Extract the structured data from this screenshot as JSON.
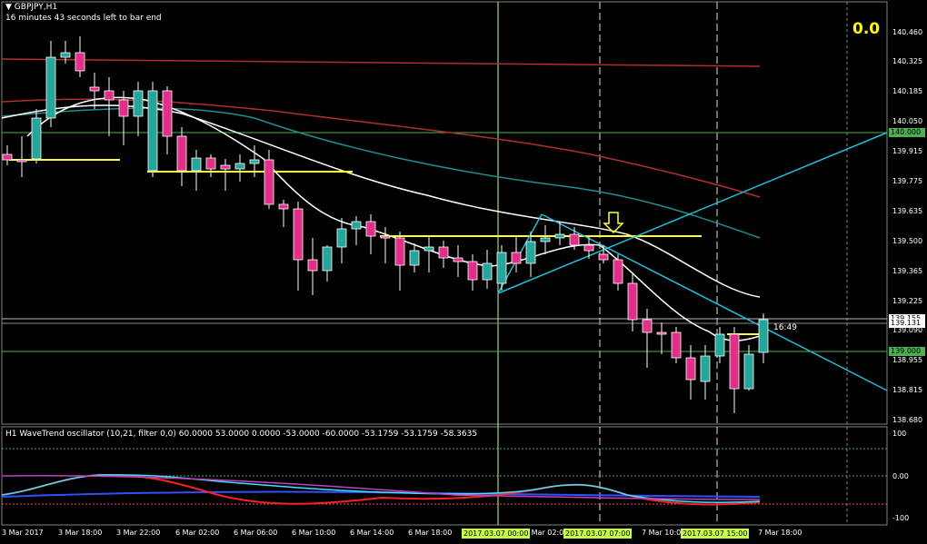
{
  "header": {
    "symbol": "GBPJPY,H1",
    "subtitle": "16 minutes 43 seconds left to bar end",
    "corner_value": "0.0"
  },
  "oscillator": {
    "title": "H1 WaveTrend oscillator (10,21, filter 0,0) 60.0000 53.0000 0.0000 -53.0000 -60.0000 -53.1759 -53.1759 -58.3635",
    "scale": [
      "100",
      "0.00",
      "-100"
    ]
  },
  "price_scale": [
    "140.460",
    "140.325",
    "140.185",
    "140.050",
    "139.915",
    "139.775",
    "139.635",
    "139.500",
    "139.365",
    "139.225",
    "139.090",
    "138.955",
    "138.815",
    "138.680"
  ],
  "badges": {
    "level_upper": "140.000",
    "bid": "139.155",
    "current": "139.131",
    "level_lower": "139.000",
    "timer": "16:49"
  },
  "time_axis": {
    "labels": [
      "3 Mar 2017",
      "3 Mar 18:00",
      "3 Mar 22:00",
      "6 Mar 02:00",
      "6 Mar 06:00",
      "6 Mar 10:00",
      "6 Mar 14:00",
      "6 Mar 18:00",
      "6 Mar 22:00",
      "7 Mar 02:00",
      "7 Mar 06:00",
      "7 Mar 10:00",
      "7 Mar 14:00",
      "7 Mar 18:00"
    ],
    "badges": [
      "2017.03.07 00:00",
      "2017.03.07 07:00",
      "2017.03.07 15:00"
    ]
  },
  "colors": {
    "bull": "#26a69a",
    "bear": "#e0308a",
    "ma_slow": "#b03030",
    "ma_mid": "#1f8f8f",
    "ma_fast": "#ffffff",
    "trendline": "#20c0d8",
    "support": "#ffff33",
    "level": "#4caf50"
  }
}
